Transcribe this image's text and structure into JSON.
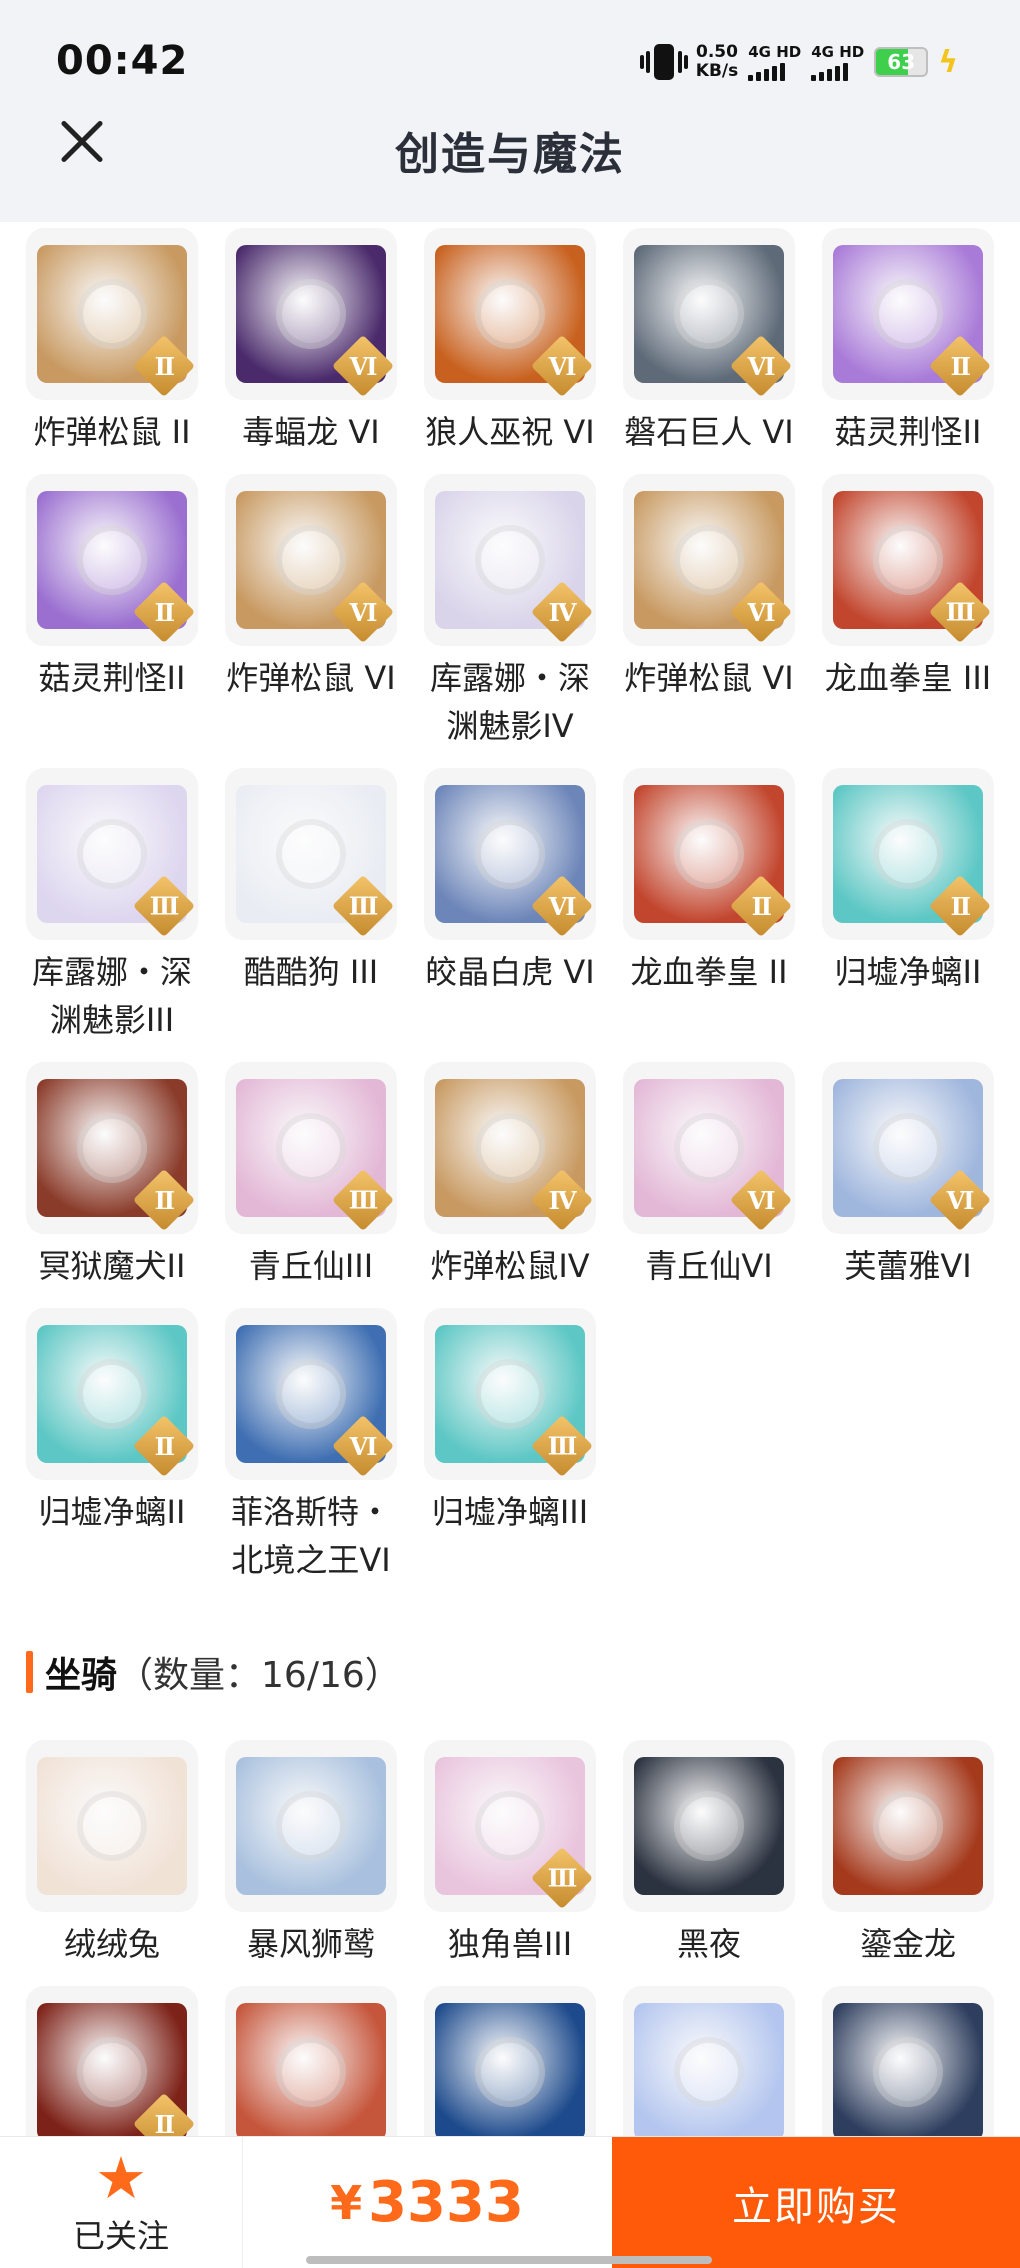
{
  "status": {
    "time": "00:42",
    "speed_value": "0.50",
    "speed_unit": "KB/s",
    "sim1": "4G HD",
    "sim2": "4G HD",
    "battery": "63",
    "battery_level_percent": 63,
    "icons": [
      "vibrate-icon",
      "signal-icon",
      "battery-icon",
      "charging-icon"
    ]
  },
  "header": {
    "title": "创造与魔法",
    "close_icon": "close-icon"
  },
  "pets": [
    {
      "name": "炸弹松鼠 II",
      "tier": "II",
      "color": "#c89a62"
    },
    {
      "name": "毒蝠龙 VI",
      "tier": "VI",
      "color": "#4a2a6b"
    },
    {
      "name": "狼人巫祝 VI",
      "tier": "VI",
      "color": "#c8611f"
    },
    {
      "name": "磐石巨人 VI",
      "tier": "VI",
      "color": "#5e6a78"
    },
    {
      "name": "菇灵荆怪II",
      "tier": "II",
      "color": "#a97bd8"
    },
    {
      "name": "菇灵荆怪II",
      "tier": "II",
      "color": "#9a6fd0"
    },
    {
      "name": "炸弹松鼠 VI",
      "tier": "VI",
      "color": "#c89a62"
    },
    {
      "name": "库露娜・深渊魅影IV",
      "tier": "IV",
      "color": "#d9d4ea"
    },
    {
      "name": "炸弹松鼠 VI",
      "tier": "VI",
      "color": "#c89a62"
    },
    {
      "name": "龙血拳皇 III",
      "tier": "III",
      "color": "#c2462e"
    },
    {
      "name": "库露娜・深渊魅影III",
      "tier": "III",
      "color": "#ddd6ef"
    },
    {
      "name": "酷酷狗 III",
      "tier": "III",
      "color": "#e9edf3"
    },
    {
      "name": "皎晶白虎 VI",
      "tier": "VI",
      "color": "#6d86b9"
    },
    {
      "name": "龙血拳皇 II",
      "tier": "II",
      "color": "#c2462e"
    },
    {
      "name": "归墟净螭II",
      "tier": "II",
      "color": "#5cc7c4"
    },
    {
      "name": "冥狱魔犬II",
      "tier": "II",
      "color": "#8a3b2a"
    },
    {
      "name": "青丘仙III",
      "tier": "III",
      "color": "#e3b8d6"
    },
    {
      "name": "炸弹松鼠IV",
      "tier": "IV",
      "color": "#c89a62"
    },
    {
      "name": "青丘仙VI",
      "tier": "VI",
      "color": "#e3b8d6"
    },
    {
      "name": "芙蕾雅VI",
      "tier": "VI",
      "color": "#9fb6dd"
    },
    {
      "name": "归墟净螭II",
      "tier": "II",
      "color": "#5cc7c4"
    },
    {
      "name": "菲洛斯特・北境之王VI",
      "tier": "VI",
      "color": "#3f6fb2"
    },
    {
      "name": "归墟净螭III",
      "tier": "III",
      "color": "#5cc7c4"
    }
  ],
  "mounts_section": {
    "title": "坐骑",
    "count_text": "（数量：16/16）"
  },
  "mounts": [
    {
      "name": "绒绒兔",
      "tier": "",
      "color": "#f1e2d6"
    },
    {
      "name": "暴风狮鹫",
      "tier": "",
      "color": "#a9c1de"
    },
    {
      "name": "独角兽III",
      "tier": "III",
      "color": "#e9c4dd"
    },
    {
      "name": "黑夜",
      "tier": "",
      "color": "#2c3340"
    },
    {
      "name": "鎏金龙",
      "tier": "",
      "color": "#a4391c"
    },
    {
      "name": "",
      "tier": "II",
      "color": "#7d2218"
    },
    {
      "name": "",
      "tier": "",
      "color": "#c5563c"
    },
    {
      "name": "",
      "tier": "",
      "color": "#1d4a8c"
    },
    {
      "name": "",
      "tier": "",
      "color": "#b4c6ef"
    },
    {
      "name": "",
      "tier": "",
      "color": "#2e3e5e"
    }
  ],
  "bottom": {
    "follow_label": "已关注",
    "currency": "¥",
    "price": "3333",
    "buy_label": "立即购买"
  },
  "colors": {
    "accent": "#ff6a1a",
    "buy_button": "#ff5a0a",
    "header_bg": "#f1f3f6"
  }
}
